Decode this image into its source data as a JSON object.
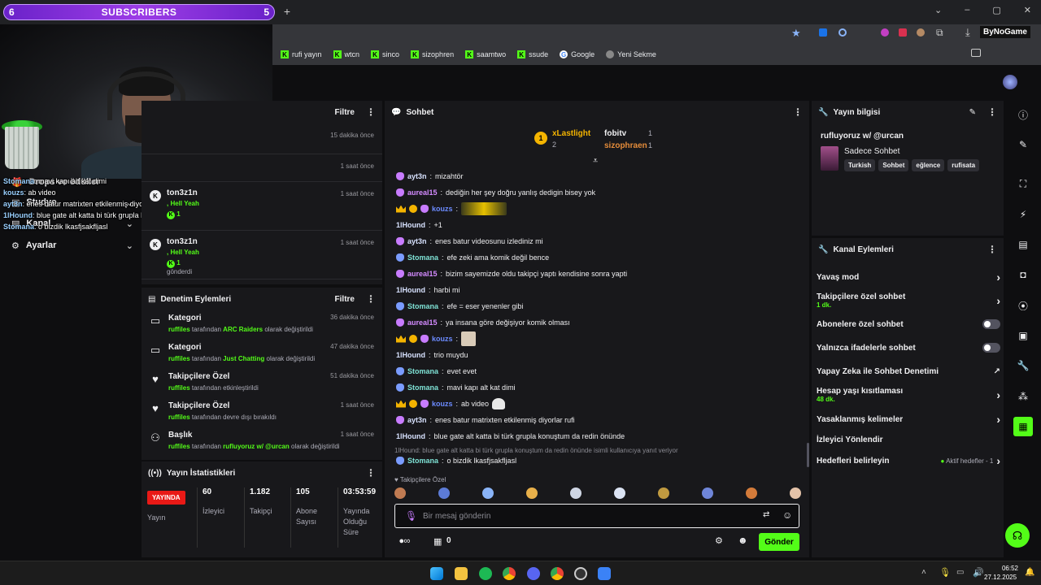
{
  "overlay": {
    "subs_left": "6",
    "subs_label": "SUBSCRIBERS",
    "subs_right": "5",
    "chat": [
      {
        "name": "Stomana",
        "text": ": mavi kapı alt kat dimi"
      },
      {
        "name": "kouzs",
        "text": ": ab video"
      },
      {
        "name": "ayt3n",
        "text": ": enes batur matrixten etkilenmiş diyorlar rufi"
      },
      {
        "name": "1lHound",
        "text": ": blue gate alt katta bi türk grupla konuştum da redin önünde"
      },
      {
        "name": "Stomana",
        "text": ": o bizdik lkasfjsakfljasl"
      }
    ]
  },
  "bookmarks": [
    {
      "label": "rufi yayın",
      "icon": "kick-icon"
    },
    {
      "label": "wtcn",
      "icon": "kick-icon"
    },
    {
      "label": "sinco",
      "icon": "kick-icon"
    },
    {
      "label": "sizophren",
      "icon": "kick-icon"
    },
    {
      "label": "saamtwo",
      "icon": "kick-icon"
    },
    {
      "label": "ssude",
      "icon": "kick-icon"
    },
    {
      "label": "Google",
      "icon": "google-icon"
    },
    {
      "label": "Yeni Sekme",
      "icon": "newtab-icon"
    }
  ],
  "browser_extra": "ByNoGame",
  "left_menu": {
    "drops": "Drops ve ödüller",
    "studio": "Studyo",
    "channel": "Kanal",
    "settings": "Ayarlar"
  },
  "activity": {
    "filter": "Filtre",
    "rows": [
      {
        "time": "15 dakika önce"
      },
      {
        "time": "1 saat önce"
      },
      {
        "name": "ton3z1n",
        "sub": "Hell Yeah",
        "count": "1",
        "time": "1 saat önce",
        "extra": ""
      },
      {
        "name": "ton3z1n",
        "sub": "Hell Yeah",
        "count": "1",
        "time": "1 saat önce",
        "extra": "gönderdi"
      }
    ]
  },
  "mod_actions": {
    "title": "Denetim Eylemleri",
    "filter": "Filtre",
    "rows": [
      {
        "title": "Kategori",
        "user": "ruffiles",
        "pre": "tarafından",
        "value": "ARC Raiders",
        "post": "olarak değiştirildi",
        "time": "36 dakika önce",
        "icon": "category-icon"
      },
      {
        "title": "Kategori",
        "user": "ruffiles",
        "pre": "tarafından",
        "value": "Just Chatting",
        "post": "olarak değiştirildi",
        "time": "47 dakika önce",
        "icon": "category-icon"
      },
      {
        "title": "Takipçilere Özel",
        "user": "ruffiles",
        "pre": "tarafından etkinleştirildi",
        "value": "",
        "post": "",
        "time": "51 dakika önce",
        "icon": "heart-icon"
      },
      {
        "title": "Takipçilere Özel",
        "user": "ruffiles",
        "pre": "tarafından devre dışı bırakıldı",
        "value": "",
        "post": "",
        "time": "1 saat önce",
        "icon": "heart-icon"
      },
      {
        "title": "Başlık",
        "user": "ruffiles",
        "pre": "tarafından",
        "value": "rufluyoruz w/ @urcan",
        "post": "olarak değiştirildi",
        "time": "1 saat önce",
        "icon": "user-edit-icon"
      }
    ]
  },
  "stats": {
    "title": "Yayın İstatistikleri",
    "live_badge": "YAYINDA",
    "live_label": "Yayın",
    "cols": [
      {
        "value": "60",
        "label": "İzleyici"
      },
      {
        "value": "1.182",
        "label": "Takipçi"
      },
      {
        "value": "105",
        "label": "Abone Sayısı"
      },
      {
        "value": "03:53:59",
        "label": "Yayında Olduğu Süre"
      }
    ]
  },
  "chat": {
    "title": "Sohbet",
    "leaderboard": {
      "first": {
        "name": "xLastlight",
        "count": "2"
      },
      "second": {
        "name": "fobitv",
        "count": "1"
      },
      "third": {
        "name": "sizophraen",
        "count": "1"
      }
    },
    "messages": [
      {
        "badges": [
          "pink"
        ],
        "user": "ayt3n",
        "cls": "u-plain",
        "text": "mizahtör"
      },
      {
        "badges": [
          "pink"
        ],
        "user": "aureal15",
        "cls": "u-pink",
        "text": "dediğin her şey doğru yanlış dedigin bisey yok"
      },
      {
        "badges": [
          "crown",
          "gold",
          "pink"
        ],
        "user": "kouzs",
        "cls": "u-blue",
        "text": "",
        "emote": "wide"
      },
      {
        "badges": [],
        "user": "1lHound",
        "cls": "u-plain",
        "text": "+1"
      },
      {
        "badges": [
          "pink"
        ],
        "user": "ayt3n",
        "cls": "u-plain",
        "text": "enes batur videosunu izlediniz mi"
      },
      {
        "badges": [
          "blue"
        ],
        "user": "Stomana",
        "cls": "u-teal",
        "text": "efe zeki ama komik değil bence"
      },
      {
        "badges": [
          "pink"
        ],
        "user": "aureal15",
        "cls": "u-pink",
        "text": "bizim sayemizde oldu takipçi yaptı kendisine sonra yapti"
      },
      {
        "badges": [],
        "user": "1lHound",
        "cls": "u-plain",
        "text": "harbi mi"
      },
      {
        "badges": [
          "blue"
        ],
        "user": "Stomana",
        "cls": "u-teal",
        "text": "efe = eser yenenler gibi"
      },
      {
        "badges": [
          "pink"
        ],
        "user": "aureal15",
        "cls": "u-pink",
        "text": "ya insana göre değişiyor komik olması"
      },
      {
        "badges": [
          "crown",
          "gold",
          "pink"
        ],
        "user": "kouzs",
        "cls": "u-blue",
        "text": "",
        "emote": "small"
      },
      {
        "badges": [],
        "user": "1lHound",
        "cls": "u-plain",
        "text": "trio muydu"
      },
      {
        "badges": [
          "blue"
        ],
        "user": "Stomana",
        "cls": "u-teal",
        "text": "evet evet"
      },
      {
        "badges": [
          "blue"
        ],
        "user": "Stomana",
        "cls": "u-teal",
        "text": "mavi kapı alt kat dimi"
      },
      {
        "badges": [
          "crown",
          "gold",
          "pink"
        ],
        "user": "kouzs",
        "cls": "u-blue",
        "text": "ab video",
        "emote": "hat"
      },
      {
        "badges": [
          "pink"
        ],
        "user": "ayt3n",
        "cls": "u-plain",
        "text": "enes batur matrixten etkilenmiş diyorlar rufi"
      },
      {
        "badges": [],
        "user": "1lHound",
        "cls": "u-plain",
        "text": "blue gate alt katta bi türk grupla konuştum da redin önünde"
      }
    ],
    "reply_hint": "1lHound: blue gate alt katta bi türk grupla konuştum da redin önünde isimli kullanıcıya yanıt veriyor",
    "reply": {
      "user": "Stomana",
      "text": "o bizdik lkasfjsakfljasl"
    },
    "followers_only": "Takipçilere Özel",
    "placeholder": "Bir mesaj gönderin",
    "points": "0",
    "send": "Gönder"
  },
  "stream_info": {
    "title": "Yayın bilgisi",
    "stream_title": "rufluyoruz w/ @urcan",
    "category": "Sadece Sohbet",
    "tags": [
      "Turkish",
      "Sohbet",
      "eğlence",
      "rufisata"
    ]
  },
  "channel_actions": {
    "title": "Kanal Eylemleri",
    "slow": "Yavaş mod",
    "followers": "Takipçilere özel sohbet",
    "followers_sub": "1 dk.",
    "subs": "Abonelere özel sohbet",
    "emotes": "Yalnızca ifadelerle sohbet",
    "ai": "Yapay Zeka ile Sohbet Denetimi",
    "age": "Hesap yaşı kısıtlaması",
    "age_sub": "48 dk.",
    "banned": "Yasaklanmış kelimeler",
    "redirect": "İzleyici Yönlendir",
    "goals": "Hedefleri belirleyin",
    "goals_status": "Aktif hedefler - 1"
  },
  "taskbar": {
    "time": "06:52",
    "date": "27.12.2025"
  },
  "colors": {
    "brand": "#53fc18",
    "panel": "#18181b",
    "bg": "#0e0e10"
  }
}
